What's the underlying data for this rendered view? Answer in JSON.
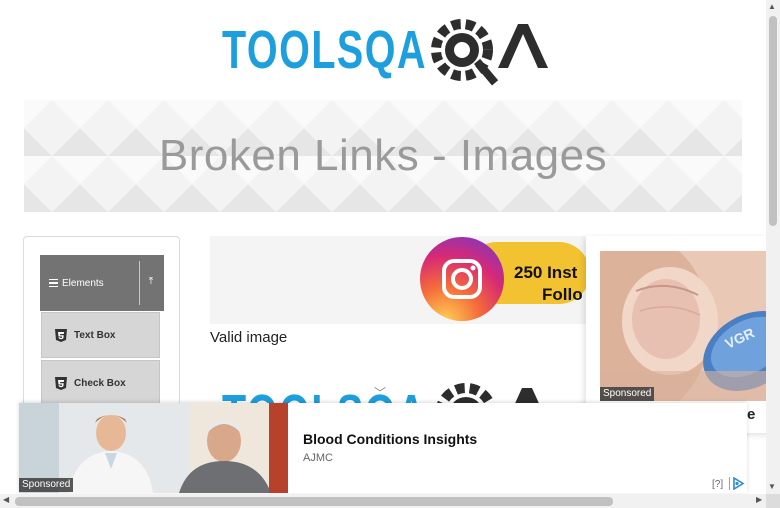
{
  "header": {
    "logo_text": "TOOLSQA"
  },
  "banner": {
    "title": "Broken Links - Images"
  },
  "sidebar": {
    "group": {
      "title": "Elements",
      "icon": "hamburger-icon",
      "toggle_icon": "chevron-up-icon"
    },
    "items": [
      {
        "label": "Text Box",
        "icon": "html5-icon"
      },
      {
        "label": "Check Box",
        "icon": "html5-icon"
      }
    ]
  },
  "main": {
    "valid_image": {
      "caption": "Valid image",
      "ad_text_line1": "250 Inst",
      "ad_text_line2": "Follo"
    },
    "broken_image": {
      "alt": "TOOLSQA"
    }
  },
  "right_ad": {
    "sponsored_label": "Sponsored",
    "pill_text": "VGR",
    "partial_text": "ore"
  },
  "bottom_ad": {
    "sponsored_label": "Sponsored",
    "title": "Blood Conditions Insights",
    "source": "AJMC",
    "help": "[?]",
    "adchoices_icon": "adchoices-icon"
  },
  "colors": {
    "logo_blue": "#1d9fde",
    "logo_dark": "#2d2d2d",
    "banner_text": "#9a9a9a",
    "sidebar_header": "#737373",
    "menu_item": "#d6d6d6"
  }
}
